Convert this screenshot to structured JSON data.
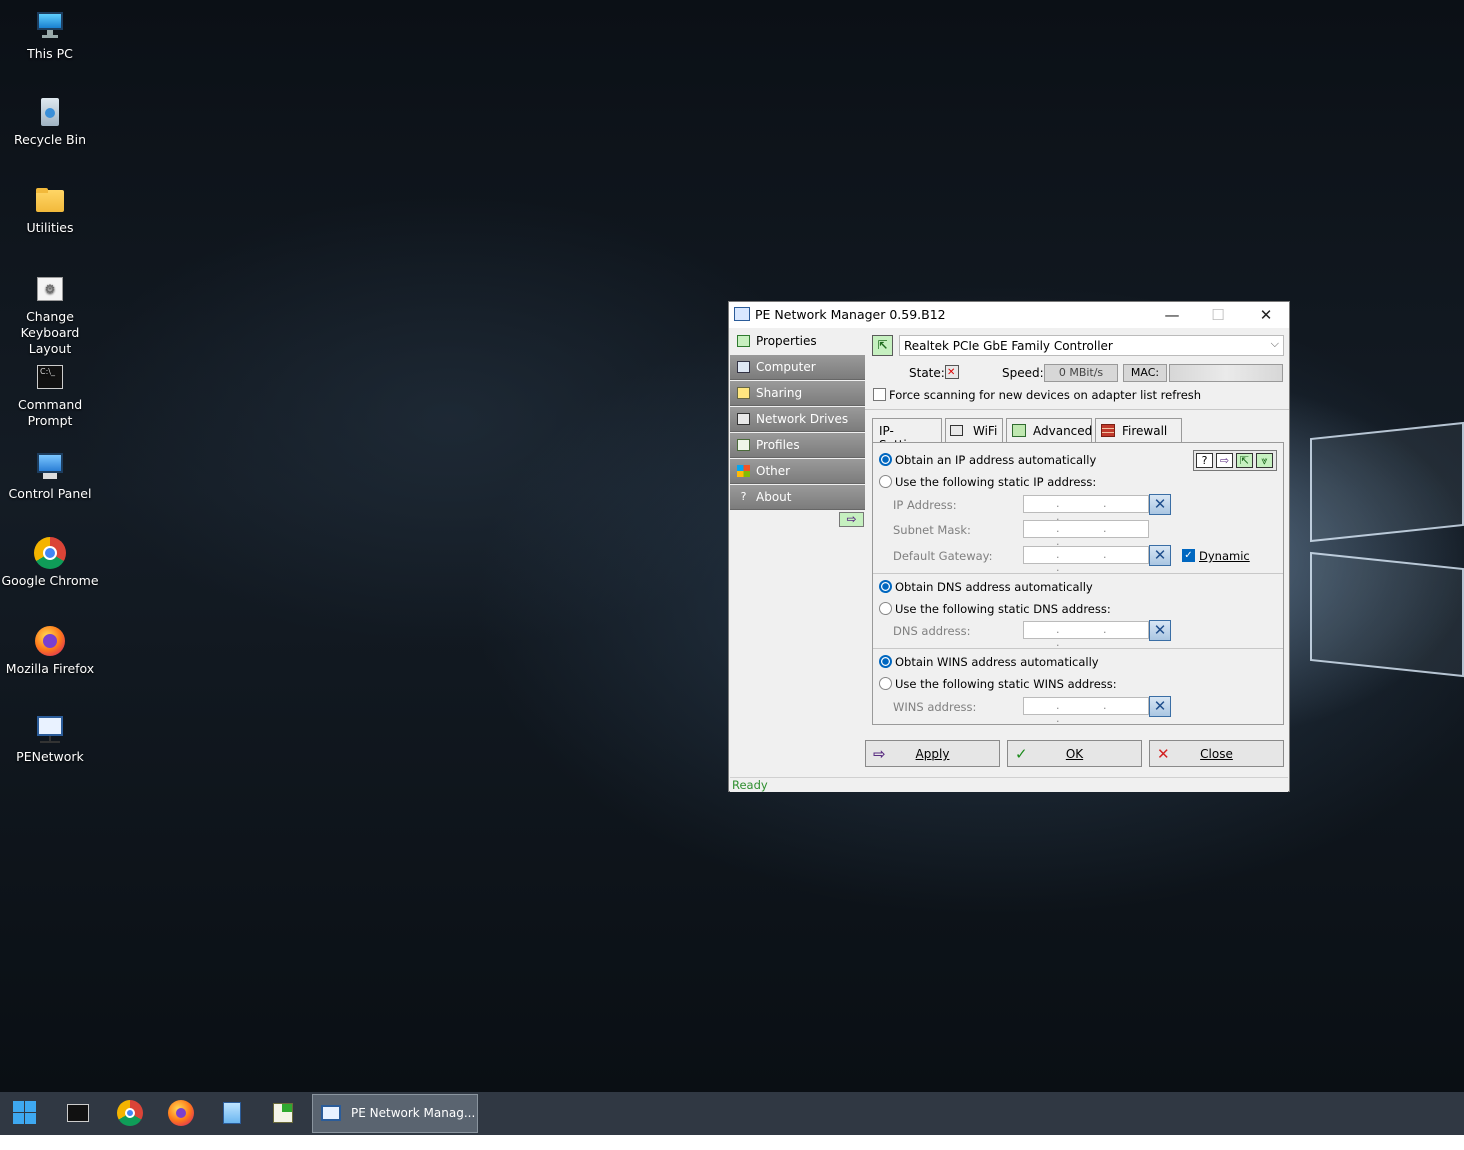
{
  "desktop": {
    "icons": [
      {
        "label": "This PC",
        "icon": "monitor-icon"
      },
      {
        "label": "Recycle Bin",
        "icon": "recycle-bin-icon"
      },
      {
        "label": "Utilities",
        "icon": "folder-icon"
      },
      {
        "label": "Change Keyboard Layout",
        "icon": "keyboard-settings-icon"
      },
      {
        "label": "Command Prompt",
        "icon": "terminal-icon"
      },
      {
        "label": "Control Panel",
        "icon": "control-panel-icon"
      },
      {
        "label": "Google Chrome",
        "icon": "chrome-icon"
      },
      {
        "label": "Mozilla Firefox",
        "icon": "firefox-icon"
      },
      {
        "label": "PENetwork",
        "icon": "penetwork-icon"
      }
    ]
  },
  "window": {
    "title": "PE Network Manager 0.59.B12",
    "nav": [
      {
        "label": "Properties",
        "icon": "properties-icon"
      },
      {
        "label": "Computer",
        "icon": "computer-icon"
      },
      {
        "label": "Sharing",
        "icon": "sharing-icon"
      },
      {
        "label": "Network Drives",
        "icon": "network-drives-icon"
      },
      {
        "label": "Profiles",
        "icon": "profiles-icon"
      },
      {
        "label": "Other",
        "icon": "other-icon"
      },
      {
        "label": "About",
        "icon": "about-icon"
      }
    ],
    "adapter": "Realtek PCIe GbE Family Controller",
    "state_label": "State:",
    "speed_label": "Speed:",
    "speed_value": "0 MBit/s",
    "mac_label": "MAC:",
    "force_scan_label": "Force scanning for new devices on adapter list refresh",
    "tabs": [
      "IP-Settings",
      "WiFi",
      "Advanced",
      "Firewall"
    ],
    "ip": {
      "auto_label": "Obtain an IP address automatically",
      "static_label": "Use the following static IP address:",
      "ip_address_label": "IP Address:",
      "subnet_label": "Subnet Mask:",
      "gateway_label": "Default Gateway:",
      "dynamic_label": "Dynamic",
      "field_placeholder": ". . ."
    },
    "dns": {
      "auto_label": "Obtain DNS address automatically",
      "static_label": "Use the following static DNS address:",
      "address_label": "DNS address:"
    },
    "wins": {
      "auto_label": "Obtain WINS address automatically",
      "static_label": "Use the following static WINS address:",
      "address_label": "WINS address:"
    },
    "buttons": {
      "apply": "Apply",
      "ok": "OK",
      "close": "Close"
    },
    "status": "Ready"
  },
  "taskbar": {
    "active_app": "PE Network Manag..."
  },
  "colors": {
    "accent": "#0067c0",
    "status_green": "#2f8f2f",
    "taskbar": "#303843"
  }
}
